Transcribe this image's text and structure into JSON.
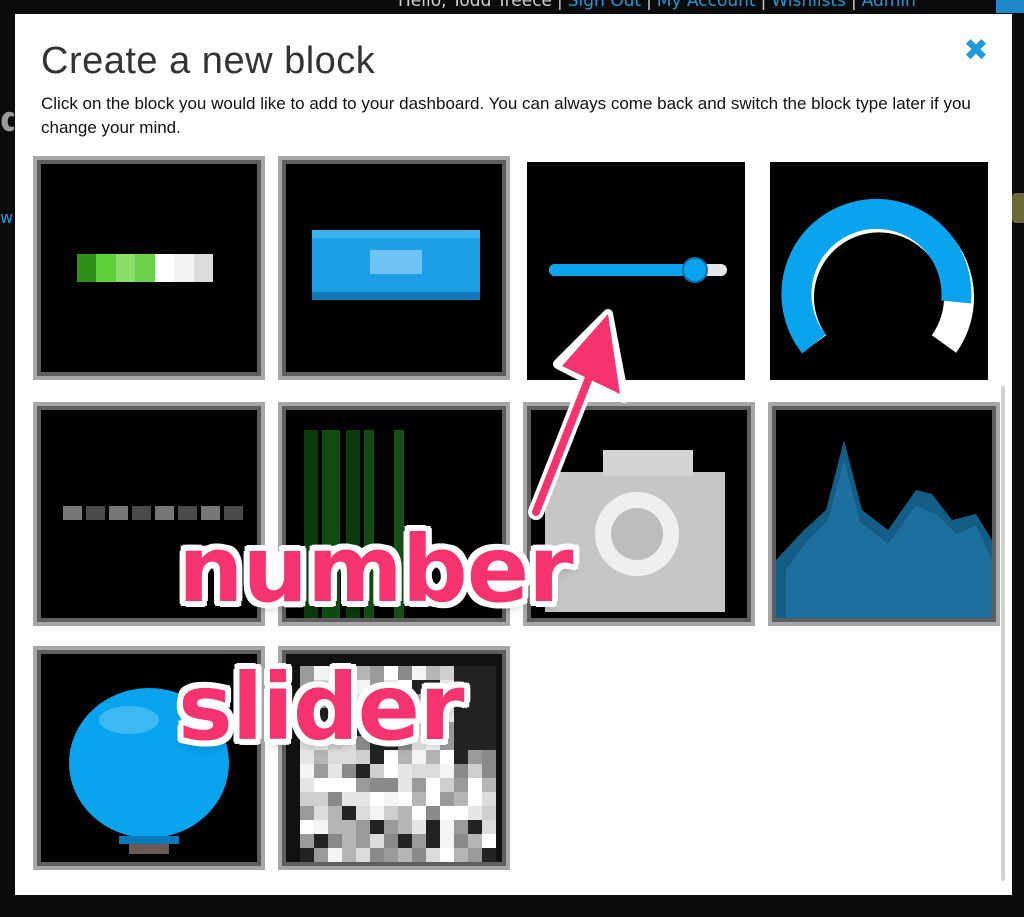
{
  "top_nav": {
    "greeting": "Hello, Todd Treece",
    "links": [
      "Sign Out",
      "My Account",
      "Wishlists",
      "Admin"
    ]
  },
  "modal": {
    "title": "Create a new block",
    "close_icon": "close-icon",
    "description": "Click on the block you would like to add to your dashboard. You can always come back and switch the block type later if you change your mind."
  },
  "blocks": [
    {
      "id": "toggle",
      "icon": "toggle-block-icon"
    },
    {
      "id": "button",
      "icon": "momentary-button-block-icon"
    },
    {
      "id": "slider",
      "icon": "slider-block-icon",
      "slider_value": 0.82
    },
    {
      "id": "gauge",
      "icon": "gauge-block-icon",
      "gauge_value": 0.85
    },
    {
      "id": "text",
      "icon": "text-block-icon"
    },
    {
      "id": "stream",
      "icon": "stream-block-icon"
    },
    {
      "id": "image",
      "icon": "camera-block-icon"
    },
    {
      "id": "chart",
      "icon": "line-chart-block-icon"
    },
    {
      "id": "indicator",
      "icon": "indicator-block-icon"
    },
    {
      "id": "color",
      "icon": "color-picker-block-icon"
    }
  ],
  "annotation": {
    "line1": "number",
    "line2": "slider",
    "color": "#f5346f"
  },
  "colors": {
    "accent": "#1e9ad8",
    "block_blue": "#0aa3ee"
  }
}
